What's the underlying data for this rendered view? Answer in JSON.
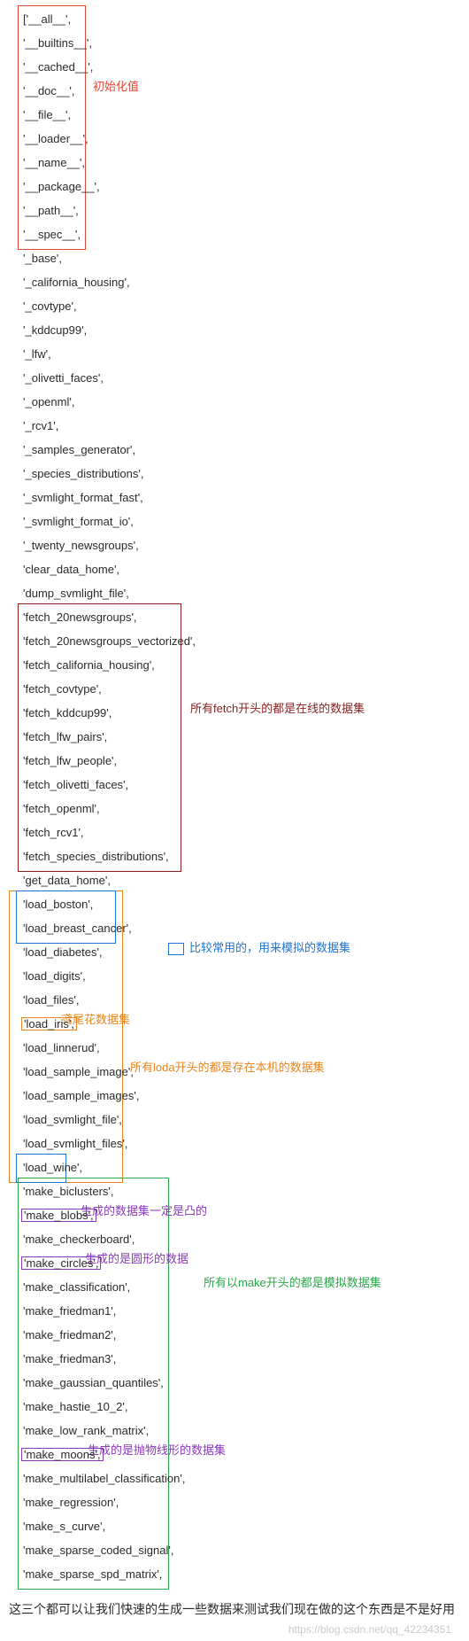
{
  "items": [
    "['__all__',",
    "'__builtins__',",
    "'__cached__',",
    "'__doc__',",
    "'__file__',",
    "'__loader__',",
    "'__name__',",
    "'__package__',",
    "'__path__',",
    "'__spec__',",
    "'_base',",
    "'_california_housing',",
    "'_covtype',",
    "'_kddcup99',",
    "'_lfw',",
    "'_olivetti_faces',",
    "'_openml',",
    "'_rcv1',",
    "'_samples_generator',",
    "'_species_distributions',",
    "'_svmlight_format_fast',",
    "'_svmlight_format_io',",
    "'_twenty_newsgroups',",
    "'clear_data_home',",
    "'dump_svmlight_file',",
    "'fetch_20newsgroups',",
    "'fetch_20newsgroups_vectorized',",
    "'fetch_california_housing',",
    "'fetch_covtype',",
    "'fetch_kddcup99',",
    "'fetch_lfw_pairs',",
    "'fetch_lfw_people',",
    "'fetch_olivetti_faces',",
    "'fetch_openml',",
    "'fetch_rcv1',",
    "'fetch_species_distributions',",
    "'get_data_home',",
    "'load_boston',",
    "'load_breast_cancer',",
    "'load_diabetes',",
    "'load_digits',",
    "'load_files',",
    "'load_iris',",
    "'load_linnerud',",
    "'load_sample_image',",
    "'load_sample_images',",
    "'load_svmlight_file',",
    "'load_svmlight_files',",
    "'load_wine',",
    "'make_biclusters',",
    "'make_blobs',",
    "'make_checkerboard',",
    "'make_circles',",
    "'make_classification',",
    "'make_friedman1',",
    "'make_friedman2',",
    "'make_friedman3',",
    "'make_gaussian_quantiles',",
    "'make_hastie_10_2',",
    "'make_low_rank_matrix',",
    "'make_moons',",
    "'make_multilabel_classification',",
    "'make_regression',",
    "'make_s_curve',",
    "'make_sparse_coded_signal',",
    "'make_sparse_spd_matrix',"
  ],
  "ann": {
    "init": "初始化值",
    "fetch": "所有fetch开头的都是在线的数据集",
    "iris": "鸢尾花数据集",
    "common": "比较常用的，用来模拟的数据集",
    "load": "所有loda开头的都是存在本机的数据集",
    "blobs": "生成的数据集一定是凸的",
    "circles": "生成的是圆形的数据",
    "make": "所有以make开头的都是模拟数据集",
    "moons": "生成的是抛物线形的数据集"
  },
  "footer": "这三个都可以让我们快速的生成一些数据来测试我们现在做的这个东西是不是好用",
  "watermark": "https://blog.csdn.net/qq_42234351",
  "colors": {
    "red": "#e24a3a",
    "darkred": "#8b1e1e",
    "orange": "#e8851c",
    "blue": "#1e74d0",
    "green": "#2ba84a",
    "purple": "#8a3ab9"
  },
  "inline": {
    "42": "orange",
    "50": "purple",
    "52": "purple",
    "60": "purple"
  }
}
